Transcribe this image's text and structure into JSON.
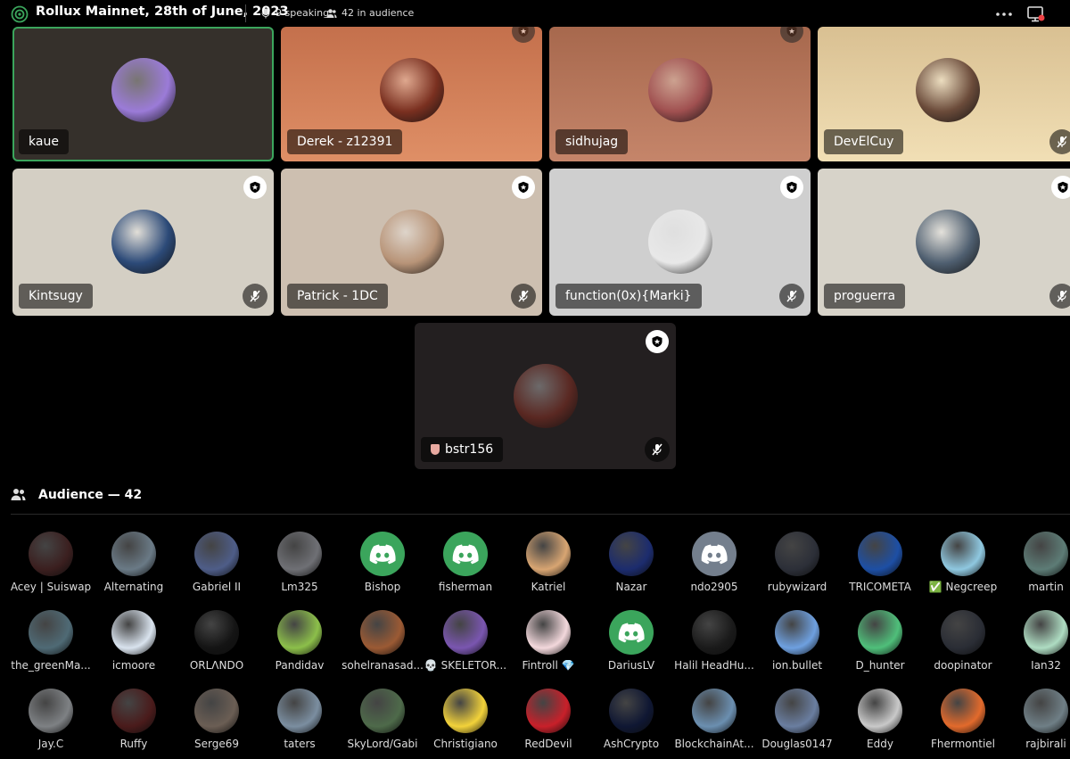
{
  "header": {
    "title": "Rollux Mainnet, 28th of June, 2023",
    "speaking": "9 speaking",
    "audience": "42 in audience",
    "icons": [
      "stage-channel-icon",
      "microphone-icon",
      "people-icon",
      "more-icon",
      "screen-share-icon"
    ]
  },
  "speakers": [
    {
      "name": "kaue",
      "bg": "#35302b",
      "avatar": "#9b7bd8",
      "active": true
    },
    {
      "name": "Derek - z12391",
      "bg": "#d4845c",
      "avatar": "#7a3020",
      "active": false
    },
    {
      "name": "sidhujag",
      "bg": "#b7765a",
      "avatar": "#a05050",
      "active": false
    },
    {
      "name": "DevElCuy",
      "bg": "#e6cfa2",
      "avatar": "#6b4b3a",
      "active": false
    },
    {
      "name": "Kintsugy",
      "bg": "#d4cfc4",
      "avatar": "#2c4a78",
      "active": false
    },
    {
      "name": "Patrick - 1DC",
      "bg": "#cdbfb0",
      "avatar": "#b89478",
      "active": false
    },
    {
      "name": "function(0x){Marki}",
      "bg": "#cfcfcf",
      "avatar": "#e8e8e8",
      "active": false
    },
    {
      "name": "proguerra",
      "bg": "#d7d3c9",
      "avatar": "#4f5f70",
      "active": false
    },
    {
      "name": "bstr156",
      "bg": "#231f20",
      "avatar": "#5a2822",
      "active": false
    }
  ],
  "audience_header": "Audience — 42",
  "audience": [
    {
      "name": "Acey | Suiswap",
      "color": "#3b1f1f"
    },
    {
      "name": "Alternating",
      "color": "#6a7a86"
    },
    {
      "name": "Gabriel II",
      "color": "#4e5d88"
    },
    {
      "name": "Lm325",
      "color": "#6f7075"
    },
    {
      "name": "Bishop",
      "color": "#3ba55c"
    },
    {
      "name": "fisherman",
      "color": "#3ba55c"
    },
    {
      "name": "Katriel",
      "color": "#d8a572"
    },
    {
      "name": "Nazar",
      "color": "#1c2c6e"
    },
    {
      "name": "ndo2905",
      "color": "#747f8d"
    },
    {
      "name": "rubywizard",
      "color": "#2c2f38"
    },
    {
      "name": "TRICOMETA",
      "color": "#1d4fa5"
    },
    {
      "name": "✅ Negcreep",
      "color": "#8fc8e0"
    },
    {
      "name": "martin",
      "color": "#5d7c76"
    },
    {
      "name": "the_greenMa...",
      "color": "#4f6a75"
    },
    {
      "name": "icmoore",
      "color": "#d9e3ee"
    },
    {
      "name": "ORLΛNDO",
      "color": "#141414"
    },
    {
      "name": "Pandidav",
      "color": "#8cbf4a"
    },
    {
      "name": "sohelranasad...",
      "color": "#9b5a34"
    },
    {
      "name": "💀 SKELETOR...",
      "color": "#7a56b0"
    },
    {
      "name": "Fintroll 💎",
      "color": "#f3d8dc"
    },
    {
      "name": "DariusLV",
      "color": "#3ba55c"
    },
    {
      "name": "Halil HeadHu...",
      "color": "#1a1a1a"
    },
    {
      "name": "ion.bullet",
      "color": "#6ea0e0"
    },
    {
      "name": "D_hunter",
      "color": "#4fbf7a"
    },
    {
      "name": "doopinator",
      "color": "#2a2d35"
    },
    {
      "name": "Ian32",
      "color": "#aedcc2"
    },
    {
      "name": "Jay.C",
      "color": "#7e8184"
    },
    {
      "name": "Ruffy",
      "color": "#4a1b1b"
    },
    {
      "name": "Serge69",
      "color": "#6b5e54"
    },
    {
      "name": "taters",
      "color": "#7b8ea0"
    },
    {
      "name": "SkyLord/Gabi",
      "color": "#4e6a4a"
    },
    {
      "name": "Christigiano",
      "color": "#f2d23a"
    },
    {
      "name": "RedDevil",
      "color": "#c8202a"
    },
    {
      "name": "AshCrypto",
      "color": "#0f1733"
    },
    {
      "name": "BlockchainAt...",
      "color": "#6b8fb0"
    },
    {
      "name": "Douglas0147",
      "color": "#6a7ea0"
    },
    {
      "name": "Eddy",
      "color": "#c9c9c9"
    },
    {
      "name": "Fhermontiel",
      "color": "#e26a2c"
    },
    {
      "name": "rajbirali",
      "color": "#6f7f86"
    }
  ]
}
